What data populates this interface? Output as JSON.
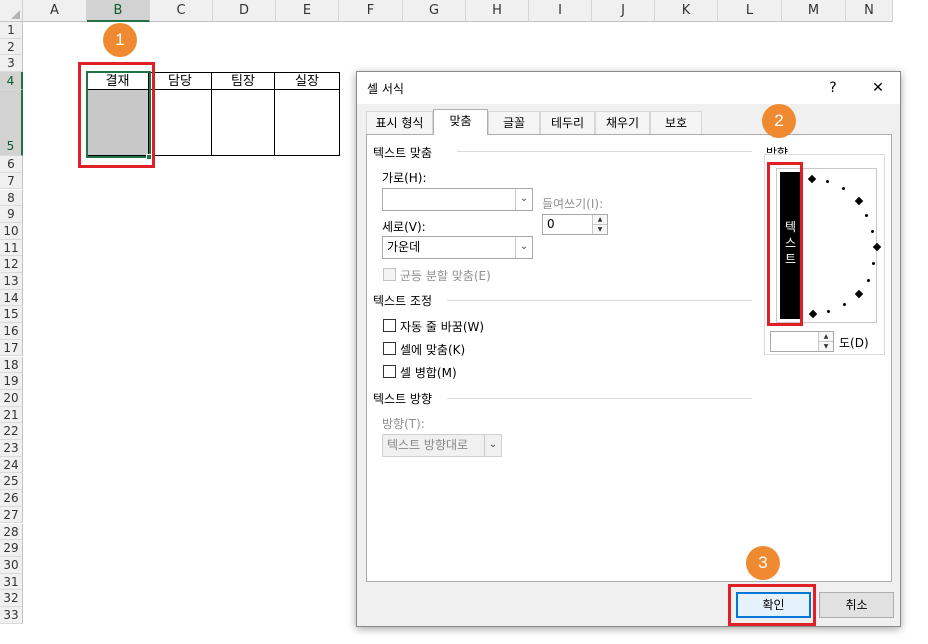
{
  "sheet": {
    "columns": [
      "A",
      "B",
      "C",
      "D",
      "E",
      "F",
      "G",
      "H",
      "I",
      "J",
      "K",
      "L",
      "M",
      "N"
    ],
    "rows": [
      "1",
      "2",
      "3",
      "4",
      "5",
      "6",
      "7",
      "8",
      "9",
      "10",
      "11",
      "12",
      "13",
      "14",
      "15",
      "16",
      "17",
      "18",
      "19",
      "20",
      "21",
      "22",
      "23",
      "24",
      "25",
      "26",
      "27",
      "28",
      "29",
      "30",
      "31",
      "32",
      "33"
    ],
    "approval_headers": [
      "결재",
      "담당",
      "팀장",
      "실장"
    ]
  },
  "badges": [
    "1",
    "2",
    "3"
  ],
  "dialog": {
    "title": "셀 서식",
    "help": "?",
    "close": "✕",
    "tabs": [
      "표시 형식",
      "맞춤",
      "글꼴",
      "테두리",
      "채우기",
      "보호"
    ],
    "text_align": {
      "section": "텍스트 맞춤",
      "horizontal_label": "가로(H):",
      "horizontal_value": "",
      "indent_label": "들여쓰기(I):",
      "indent_value": "0",
      "vertical_label": "세로(V):",
      "vertical_value": "가운데",
      "distributed_label": "균등 분할 맞춤(E)"
    },
    "text_control": {
      "section": "텍스트 조정",
      "wrap": "자동 줄 바꿈(W)",
      "shrink": "셀에 맞춤(K)",
      "merge": "셀 병합(M)"
    },
    "text_direction": {
      "section": "텍스트 방향",
      "direction_label": "방향(T):",
      "direction_value": "텍스트 방향대로"
    },
    "orientation": {
      "label": "방향",
      "vertical_text": [
        "텍",
        "스",
        "트"
      ],
      "degree_value": "",
      "degree_label": "도(D)"
    },
    "ok": "확인",
    "cancel": "취소"
  },
  "colors": {
    "highlight": "#e01f26",
    "badge": "#f08a30",
    "excel_green": "#217346"
  }
}
